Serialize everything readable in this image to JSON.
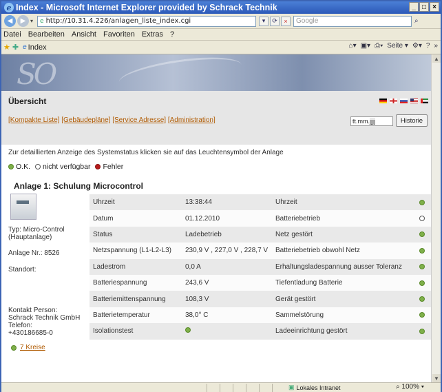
{
  "window": {
    "title": "Index - Microsoft Internet Explorer provided by Schrack Technik",
    "min": "_",
    "max": "□",
    "close": "×"
  },
  "address": {
    "url": "http://10.31.4.226/anlagen_liste_index.cgi",
    "search_placeholder": "Google"
  },
  "menu": [
    "Datei",
    "Bearbeiten",
    "Ansicht",
    "Favoriten",
    "Extras",
    "?"
  ],
  "tab": {
    "label": "Index"
  },
  "commands": {
    "page": "Seite",
    "more": "»"
  },
  "page": {
    "title": "Übersicht",
    "links": [
      "[Kompakte Liste]",
      "[Gebäudepläne]",
      "[Service Adresse]",
      "[Administration]"
    ],
    "date_value": "tt.mm.jjjj",
    "history_button": "Historie",
    "info": "Zur detaillierten Anzeige des Systemstatus klicken sie auf das Leuchtensymbol der Anlage",
    "legend": {
      "ok": "O.K.",
      "unavailable": "nicht verfügbar",
      "error": "Fehler"
    },
    "plant": {
      "title": "Anlage 1: Schulung Microcontrol",
      "type_line1": "Typ: Micro-Control",
      "type_line2": "(Hauptanlage)",
      "number": "Anlage Nr.: 8526",
      "location": "Standort:",
      "contact1": "Kontakt Person:",
      "contact2": "Schrack Technik GmbH",
      "contact3": "Telefon:",
      "contact4": "+430186685-0",
      "circuits": "7 Kreise"
    },
    "rows": [
      {
        "label": "Uhrzeit",
        "value": "13:38:44",
        "status_label": "Uhrzeit",
        "status": "ok"
      },
      {
        "label": "Datum",
        "value": "01.12.2010",
        "status_label": "Batteriebetrieb",
        "status": "unavailable"
      },
      {
        "label": "Status",
        "value": "Ladebetrieb",
        "status_label": "Netz gestört",
        "status": "ok"
      },
      {
        "label": "Netzspannung (L1-L2-L3)",
        "value": "230,9 V , 227,0 V , 228,7 V",
        "status_label": "Batteriebetrieb obwohl Netz",
        "status": "ok"
      },
      {
        "label": "Ladestrom",
        "value": "0,0 A",
        "status_label": "Erhaltungsladespannung ausser Toleranz",
        "status": "ok"
      },
      {
        "label": "Batteriespannung",
        "value": "243,6 V",
        "status_label": "Tiefentladung Batterie",
        "status": "ok"
      },
      {
        "label": "Batteriemittenspannung",
        "value": "108,3 V",
        "status_label": "Gerät gestört",
        "status": "ok"
      },
      {
        "label": "Batterietemperatur",
        "value": "38,0° C",
        "status_label": "Sammelstörung",
        "status": "ok"
      },
      {
        "label": "Isolationstest",
        "value": "",
        "value_status": "ok",
        "status_label": "Ladeeinrichtung gestört",
        "status": "ok"
      }
    ]
  },
  "statusbar": {
    "zone": "Lokales Intranet",
    "zoom": "100%"
  },
  "colors": {
    "ok": "#7fb04a",
    "error": "#b71c1c",
    "link": "#b05a00"
  }
}
